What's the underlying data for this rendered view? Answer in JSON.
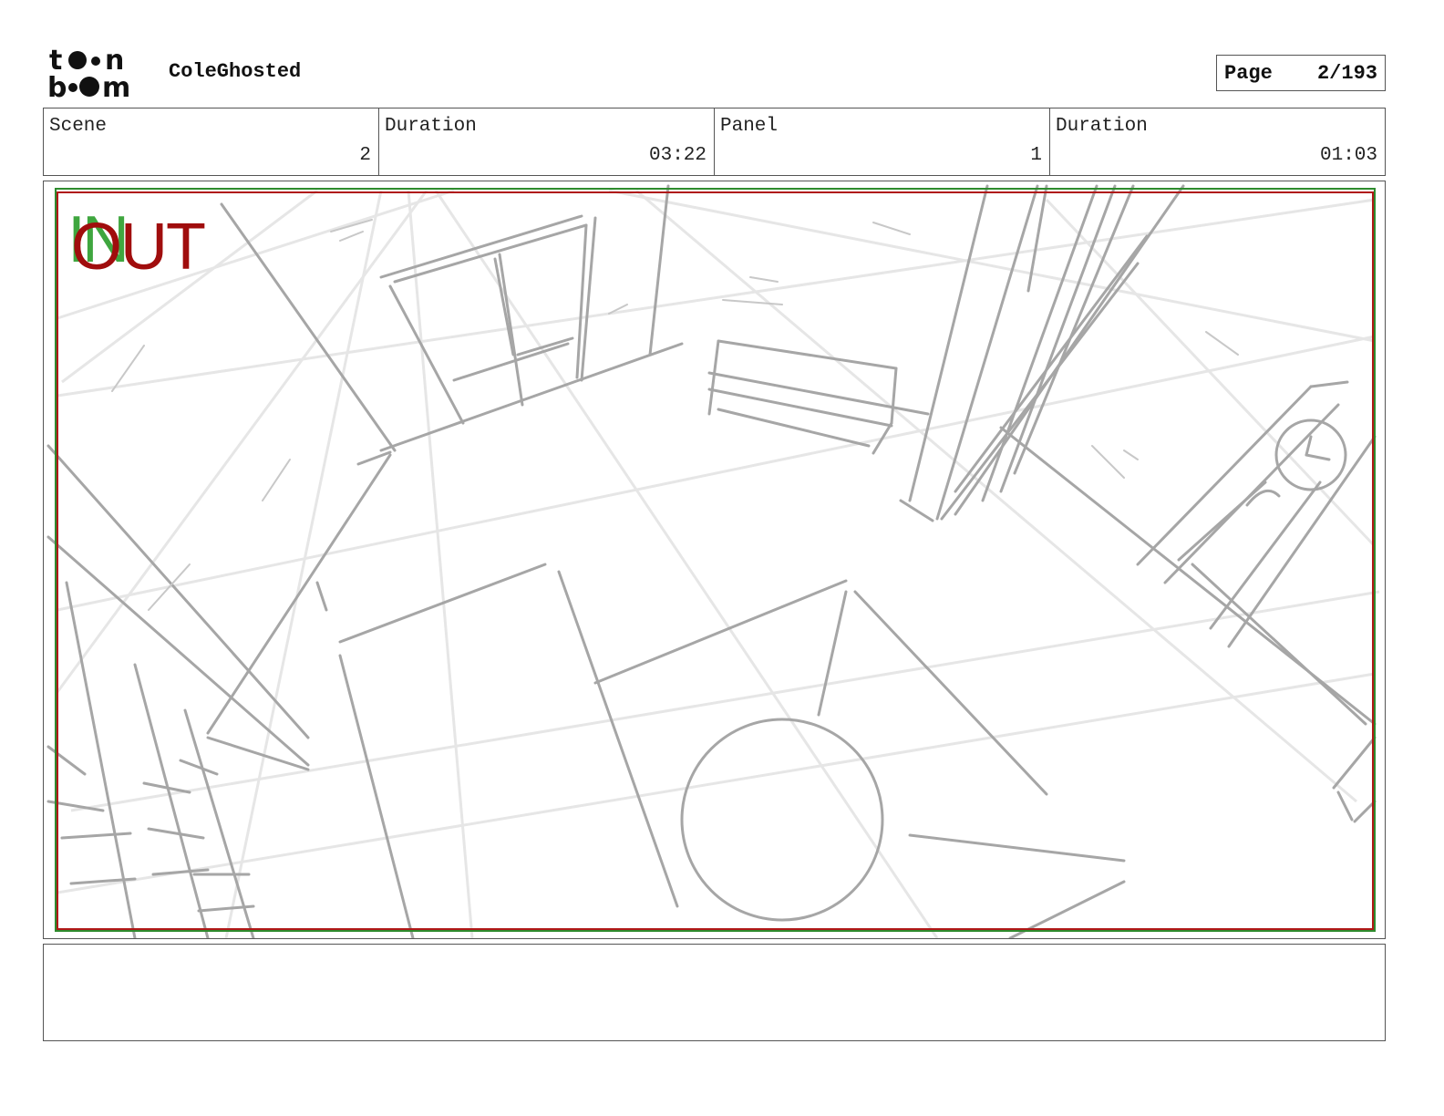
{
  "header": {
    "logo_text": "toon boom",
    "project_title": "ColeGhosted",
    "page_label": "Page",
    "page_number": "2/193"
  },
  "info": {
    "scene_label": "Scene",
    "scene_value": "2",
    "scene_duration_label": "Duration",
    "scene_duration_value": "03:22",
    "panel_label": "Panel",
    "panel_value": "1",
    "panel_duration_label": "Duration",
    "panel_duration_value": "01:03"
  },
  "panel": {
    "in_label": "IN",
    "out_label": "OUT"
  },
  "notes": {
    "text": ""
  },
  "colors": {
    "safe_frame_green": "#2e8b2e",
    "safe_frame_red": "#b01818",
    "sketch_gray": "#a6a6a6"
  }
}
